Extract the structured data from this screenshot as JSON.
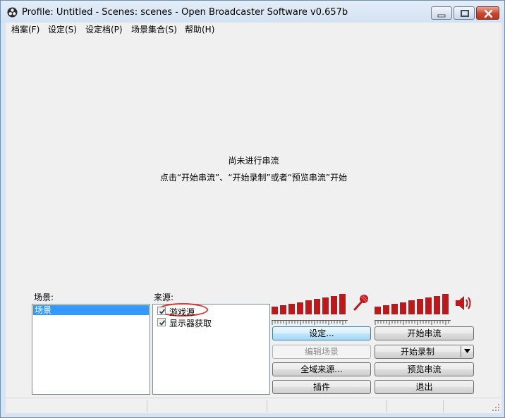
{
  "window": {
    "title": "Profile: Untitled - Scenes: scenes - Open Broadcaster Software v0.657b"
  },
  "menu": [
    {
      "label": "档案(F)"
    },
    {
      "label": "设定(S)"
    },
    {
      "label": "设定档(P)"
    },
    {
      "label": "场景集合(S)"
    },
    {
      "label": "帮助(H)"
    }
  ],
  "preview": {
    "line1": "尚未进行串流",
    "line2": "点击“开始串流”、“开始录制”或者“预览串流”开始"
  },
  "scenes": {
    "label": "场景:",
    "items": [
      "场景"
    ]
  },
  "sources": {
    "label": "来源:",
    "items": [
      {
        "label": "游戏源",
        "checked": true,
        "highlighted": true
      },
      {
        "label": "显示器获取",
        "checked": true,
        "highlighted": false
      }
    ]
  },
  "meters": {
    "levels": [
      0.35,
      0.42,
      0.5,
      0.57,
      0.65,
      0.72,
      0.8,
      0.88,
      0.95
    ],
    "color": "#c0171b"
  },
  "buttons": {
    "settings": "设定...",
    "edit_scene": "编辑场景",
    "global_sources": "全域来源...",
    "plugins": "插件",
    "start_stream": "开始串流",
    "start_record": "开始录制",
    "preview_stream": "预览串流",
    "exit": "退出"
  },
  "icons": {
    "app": "obs-logo-icon",
    "mic": "microphone-icon",
    "speaker": "speaker-icon"
  }
}
